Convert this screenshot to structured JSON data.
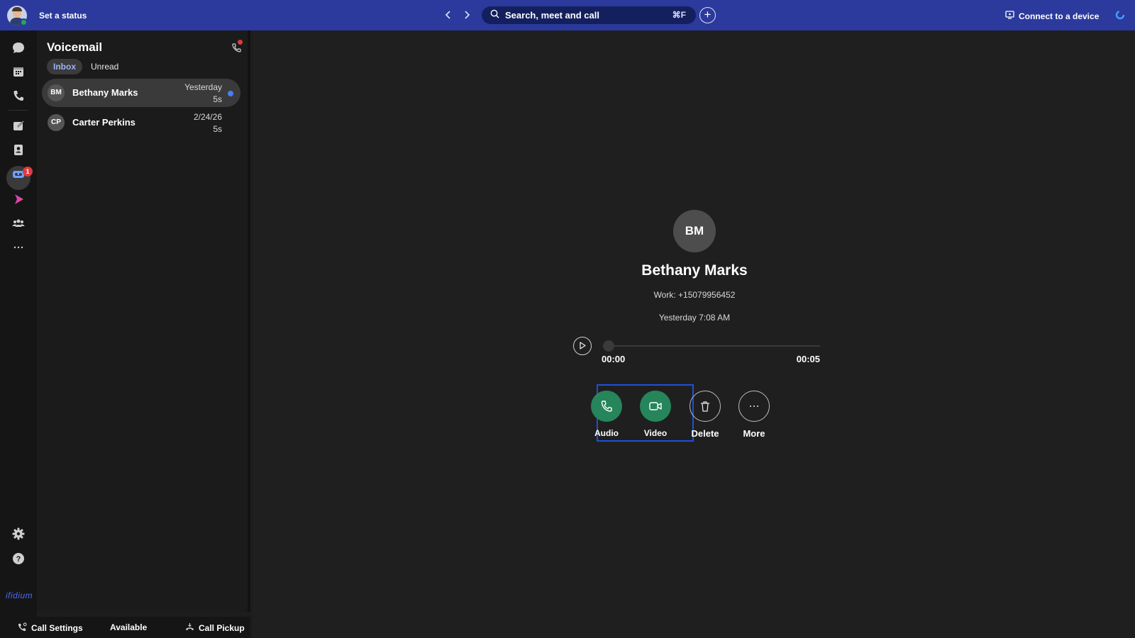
{
  "header": {
    "status_label": "Set a status",
    "search_placeholder": "Search, meet and call",
    "search_shortcut": "⌘F",
    "connect_label": "Connect to a device"
  },
  "rail": {
    "voicemail_badge": "1",
    "brand": "ifidium"
  },
  "panel": {
    "title": "Voicemail",
    "tabs": [
      {
        "label": "Inbox",
        "active": true
      },
      {
        "label": "Unread",
        "active": false
      }
    ],
    "items": [
      {
        "initials": "BM",
        "name": "Bethany Marks",
        "date": "Yesterday",
        "duration": "5s",
        "unread": true,
        "selected": true
      },
      {
        "initials": "CP",
        "name": "Carter Perkins",
        "date": "2/24/26",
        "duration": "5s",
        "unread": false,
        "selected": false
      }
    ]
  },
  "bottom": {
    "call_settings": "Call Settings",
    "availability": "Available",
    "call_pickup": "Call Pickup"
  },
  "detail": {
    "initials": "BM",
    "name": "Bethany Marks",
    "phone": "Work: +15079956452",
    "received": "Yesterday 7:08 AM",
    "time_current": "00:00",
    "time_total": "00:05",
    "progress": 0,
    "actions": {
      "audio": "Audio",
      "video": "Video",
      "delete": "Delete",
      "more": "More"
    }
  },
  "colors": {
    "topbar": "#2b3a9c",
    "green_action": "#26855a",
    "unread_dot": "#4a7dfc",
    "badge": "#e03a3e",
    "focus": "#1f4fd6"
  }
}
